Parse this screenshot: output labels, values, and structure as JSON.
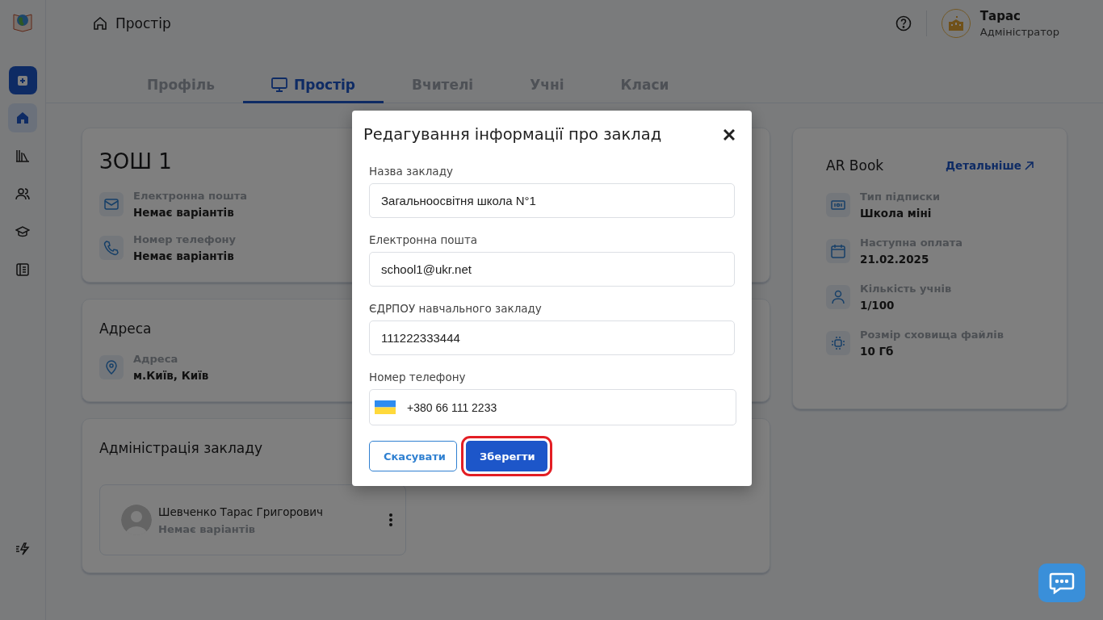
{
  "sidebar": {
    "items": [
      {
        "kind": "add",
        "selected": false
      },
      {
        "kind": "home",
        "selected": true
      },
      {
        "kind": "library",
        "selected": false
      },
      {
        "kind": "users",
        "selected": false
      },
      {
        "kind": "graduation",
        "selected": false
      },
      {
        "kind": "journal",
        "selected": false
      }
    ],
    "bottom_item": {
      "kind": "bolt"
    }
  },
  "header": {
    "breadcrumb": "Простір",
    "user_name": "Тарас",
    "user_role": "Адміністратор"
  },
  "tabs": [
    {
      "label": "Профіль",
      "selected": false
    },
    {
      "label": "Простір",
      "selected": true
    },
    {
      "label": "Вчителі",
      "selected": false
    },
    {
      "label": "Учні",
      "selected": false
    },
    {
      "label": "Класи",
      "selected": false
    }
  ],
  "school_card": {
    "title": "ЗОШ 1",
    "fields": [
      {
        "kind": "email",
        "label": "Електронна пошта",
        "value": "Немає варіантів"
      },
      {
        "kind": "phone",
        "label": "Номер телефону",
        "value": "Немає варіантів"
      }
    ]
  },
  "address_card": {
    "title": "Адреса",
    "fields": [
      {
        "kind": "location",
        "label": "Адреса",
        "value": "м.Київ, Київ"
      }
    ]
  },
  "admin_card": {
    "title": "Адміністрація закладу",
    "admins": [
      {
        "name": "Шевченко Тарас Григорович",
        "subtitle": "Немає варіантів"
      }
    ]
  },
  "subscription_card": {
    "title": "AR Book",
    "link": "Детальніше",
    "fields": [
      {
        "kind": "plan",
        "label": "Тип підписки",
        "value": "Школа міні"
      },
      {
        "kind": "calendar",
        "label": "Наступна оплата",
        "value": "21.02.2025"
      },
      {
        "kind": "person",
        "label": "Кількість учнів",
        "value": "1/100"
      },
      {
        "kind": "storage",
        "label": "Розмір сховища файлів",
        "value": "10 Гб"
      }
    ]
  },
  "modal": {
    "title": "Редагування інформації про заклад",
    "fields": [
      {
        "kind": "text",
        "label": "Назва закладу",
        "value": "Загальноосвітня школа N°1"
      },
      {
        "kind": "text",
        "label": "Електронна пошта",
        "value": "school1@ukr.net"
      },
      {
        "kind": "text",
        "label": "ЄДРПОУ навчального закладу",
        "value": "111222333444"
      },
      {
        "kind": "phone",
        "label": "Номер телефону",
        "value": "+380 66 111 2233"
      }
    ],
    "buttons": [
      {
        "kind": "secondary",
        "label": "Скасувати",
        "highlighted": false
      },
      {
        "kind": "primary",
        "label": "Зберегти",
        "highlighted": true
      }
    ]
  }
}
